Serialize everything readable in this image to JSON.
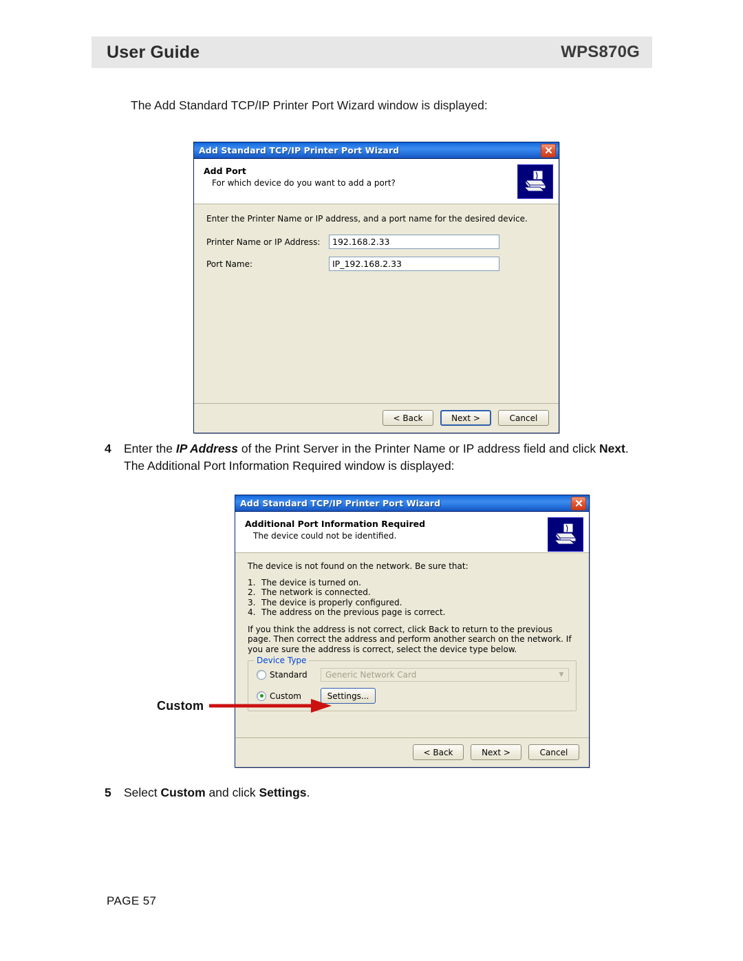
{
  "header": {
    "left_title": "User Guide",
    "right_title": "WPS870G"
  },
  "footer": {
    "page_label": "PAGE 57"
  },
  "intro": {
    "line": "The Add Standard TCP/IP Printer Port Wizard window is displayed:"
  },
  "steps": [
    {
      "number": "4",
      "parts": [
        {
          "text": "Enter the ",
          "style": "normal"
        },
        {
          "text": "IP Address",
          "style": "bold-italic"
        },
        {
          "text": " of the Print Server in the Printer Name or IP address field and click ",
          "style": "normal"
        },
        {
          "text": "Next",
          "style": "bold"
        },
        {
          "text": ". The Additional Port Information Required window is displayed:",
          "style": "normal"
        }
      ]
    },
    {
      "number": "5",
      "parts": [
        {
          "text": "Select ",
          "style": "normal"
        },
        {
          "text": "Custom",
          "style": "bold"
        },
        {
          "text": " and click ",
          "style": "normal"
        },
        {
          "text": "Settings",
          "style": "bold"
        },
        {
          "text": ".",
          "style": "normal"
        }
      ]
    }
  ],
  "dialog1": {
    "titlebar": "Add Standard TCP/IP Printer Port Wizard",
    "close_icon": "close-icon",
    "header_title": "Add Port",
    "header_subtitle": "For which device do you want to add a port?",
    "icon": "printer-icon",
    "hint": "Enter the Printer Name or IP address, and a port name for the desired device.",
    "fields": [
      {
        "label": "Printer Name or IP Address:",
        "value": "192.168.2.33",
        "accel": "A"
      },
      {
        "label": "Port Name:",
        "value": "IP_192.168.2.33",
        "accel": "P"
      }
    ],
    "buttons": [
      {
        "label": "< Back",
        "accel": "B",
        "default": false
      },
      {
        "label": "Next >",
        "accel": "N",
        "default": true
      },
      {
        "label": "Cancel",
        "accel": "",
        "default": false
      }
    ]
  },
  "dialog2": {
    "titlebar": "Add Standard TCP/IP Printer Port Wizard",
    "close_icon": "close-icon",
    "header_title": "Additional Port Information Required",
    "header_subtitle": "The device could not be identified.",
    "icon": "printer-icon",
    "intro_paragraph": "The device is not found on the network.  Be sure that:",
    "checklist": [
      {
        "num": "1.",
        "text": "The device is turned on."
      },
      {
        "num": "2.",
        "text": "The network is connected."
      },
      {
        "num": "3.",
        "text": "The device is properly configured."
      },
      {
        "num": "4.",
        "text": "The address on the previous page is correct."
      }
    ],
    "advice_paragraph": "If you think the address is not correct, click Back to return to the previous page.  Then correct the address and perform another search on the network.  If you are sure the address is correct, select the device type below.",
    "device_type": {
      "legend": "Device Type",
      "legend_color": "#0046d5",
      "standard": {
        "label": "Standard",
        "selected": false,
        "combo_value": "Generic Network Card",
        "combo_enabled": false
      },
      "custom": {
        "label": "Custom",
        "selected": true,
        "settings_label": "Settings...",
        "radio_dot_color": "#18a018"
      }
    },
    "buttons": [
      {
        "label": "< Back",
        "accel": "",
        "default": false
      },
      {
        "label": "Next >",
        "accel": "",
        "default": false
      },
      {
        "label": "Cancel",
        "accel": "",
        "default": false
      }
    ]
  },
  "callout": {
    "label": "Custom",
    "arrow_color": "#cc1111"
  }
}
